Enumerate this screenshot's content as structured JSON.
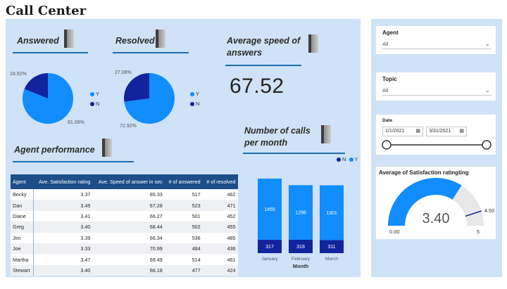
{
  "page": {
    "title": "Call Center"
  },
  "kpis": {
    "answered": {
      "title": "Answered",
      "slices": [
        {
          "label": "Y",
          "value": 81.08,
          "pct_text": "81.08%"
        },
        {
          "label": "N",
          "value": 18.92,
          "pct_text": "18.92%"
        }
      ]
    },
    "resolved": {
      "title": "Resolved",
      "slices": [
        {
          "label": "Y",
          "value": 72.92,
          "pct_text": "72.92%"
        },
        {
          "label": "N",
          "value": 27.08,
          "pct_text": "27.08%"
        }
      ]
    },
    "avg_speed": {
      "title_line1": "Average speed of",
      "title_line2": "answers",
      "value": "67.52"
    }
  },
  "colors": {
    "Y": "#118dff",
    "N": "#12239e",
    "panel": "#cfe2f7",
    "gauge_fill": "#118dff",
    "gauge_bg": "#e8e8e8",
    "target": "#12239e"
  },
  "legend": {
    "Y": "Y",
    "N": "N"
  },
  "performance": {
    "title": "Agent performance",
    "columns": [
      "Agent",
      "Ave. Satisfaction rating",
      "Ave. Speed of answer in sec",
      "# of answered",
      "# of resolved"
    ],
    "rows": [
      [
        "Becky",
        "3.37",
        "65.33",
        "517",
        "462"
      ],
      [
        "Dan",
        "3.45",
        "67.28",
        "523",
        "471"
      ],
      [
        "Diane",
        "3.41",
        "66.27",
        "501",
        "452"
      ],
      [
        "Greg",
        "3.40",
        "68.44",
        "502",
        "455"
      ],
      [
        "Jim",
        "3.39",
        "66.34",
        "536",
        "485"
      ],
      [
        "Joe",
        "3.33",
        "70.99",
        "484",
        "436"
      ],
      [
        "Martha",
        "3.47",
        "69.49",
        "514",
        "461"
      ],
      [
        "Stewart",
        "3.40",
        "66.18",
        "477",
        "424"
      ]
    ]
  },
  "calls_per_month": {
    "title_line1": "Number of calls",
    "title_line2": "per month",
    "legend": [
      "N",
      "Y"
    ]
  },
  "chart_data": {
    "type": "bar",
    "stacked": true,
    "categories": [
      "January",
      "February",
      "March"
    ],
    "series": [
      {
        "name": "N",
        "values": [
          317,
          318,
          311
        ]
      },
      {
        "name": "Y",
        "values": [
          1455,
          1298,
          1301
        ]
      }
    ],
    "xlabel": "Month",
    "ylabel": ""
  },
  "filters": {
    "agent": {
      "label": "Agent",
      "value": "All"
    },
    "topic": {
      "label": "Topic",
      "value": "All"
    },
    "date": {
      "label": "Date",
      "start": "1/1/2021",
      "end": "3/31/2021"
    }
  },
  "gauge": {
    "title": "Average of Satisfaction ratingting",
    "value": 3.4,
    "value_text": "3.40",
    "min": 0,
    "min_text": "0.00",
    "max": 5,
    "max_text": "5",
    "target": 4.5,
    "target_text": "4.50"
  }
}
